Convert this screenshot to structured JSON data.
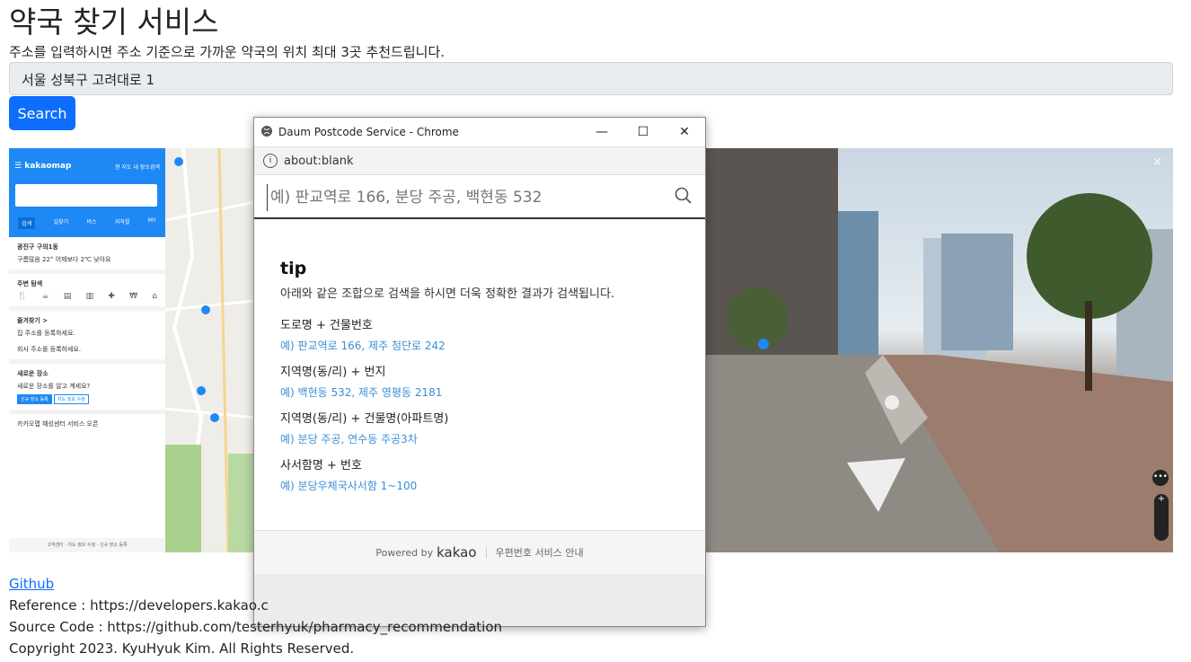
{
  "page": {
    "title": "약국 찾기 서비스",
    "description": "주소를 입력하시면 주소 기준으로 가까운 약국의 위치 최대 3곳 추천드립니다.",
    "address_value": "서울 성북구 고려대로 1",
    "search_label": "Search"
  },
  "kakao_sidebar": {
    "logo": "kakaomap",
    "top_right": "현 지도 내 장소검색",
    "tabs": [
      "검색",
      "길찾기",
      "버스",
      "지하철",
      "MY"
    ],
    "location_title": "광진구 구의1동",
    "location_weather": "구름많음 22° 어제보다 2℃ 낮아요",
    "nearby_title": "주변 탐색",
    "nearby_items": [
      "음식점",
      "카페",
      "버스",
      "지하철",
      "약국",
      "은행",
      "편의점"
    ],
    "favorites_title": "즐겨찾기 >",
    "fav_home": "집 주소를 등록하세요.",
    "fav_work": "회사 주소를 등록하세요.",
    "new_place_title": "새로운 장소",
    "new_place_desc": "새로운 장소를 알고 계세요?",
    "new_place_btn1": "신규 장소 등록",
    "new_place_btn2": "지도 정보 수정",
    "notice": "카카오맵 혜성센터 서비스 오픈",
    "footer": "고객센터 · 지도 정보 수정 · 신규 장소 등록"
  },
  "popup": {
    "window_title": "Daum Postcode Service - Chrome",
    "url": "about:blank",
    "search_placeholder": "예) 판교역로 166, 분당 주공, 백현동 532",
    "tip_title": "tip",
    "tip_desc": "아래와 같은 조합으로 검색을 하시면 더욱 정확한 결과가 검색됩니다.",
    "tips": [
      {
        "key": "도로명 + 건물번호",
        "example": "예) 판교역로 166,  제주 첨단로 242"
      },
      {
        "key": "지역명(동/리) + 번지",
        "example": "예) 백현동 532,  제주 영평동 2181"
      },
      {
        "key": "지역명(동/리) + 건물명(아파트명)",
        "example": "예) 분당 주공,  연수동 주공3차"
      },
      {
        "key": "사서함명 + 번호",
        "example": "예) 분당우체국사서함 1~100"
      }
    ],
    "powered_by": "Powered by",
    "brand": "kakao",
    "guide_link": "우편번호 서비스 안내"
  },
  "footer": {
    "github": "Github",
    "reference": "Reference : https://developers.kakao.c",
    "source": "Source Code : https://github.com/testerhyuk/pharmacy_recommendation",
    "copyright": "Copyright 2023. KyuHyuk Kim. All Rights Reserved."
  },
  "colors": {
    "primary": "#0d6efd",
    "kakao_blue": "#1e88f5",
    "tip_link": "#3c8ed6"
  }
}
